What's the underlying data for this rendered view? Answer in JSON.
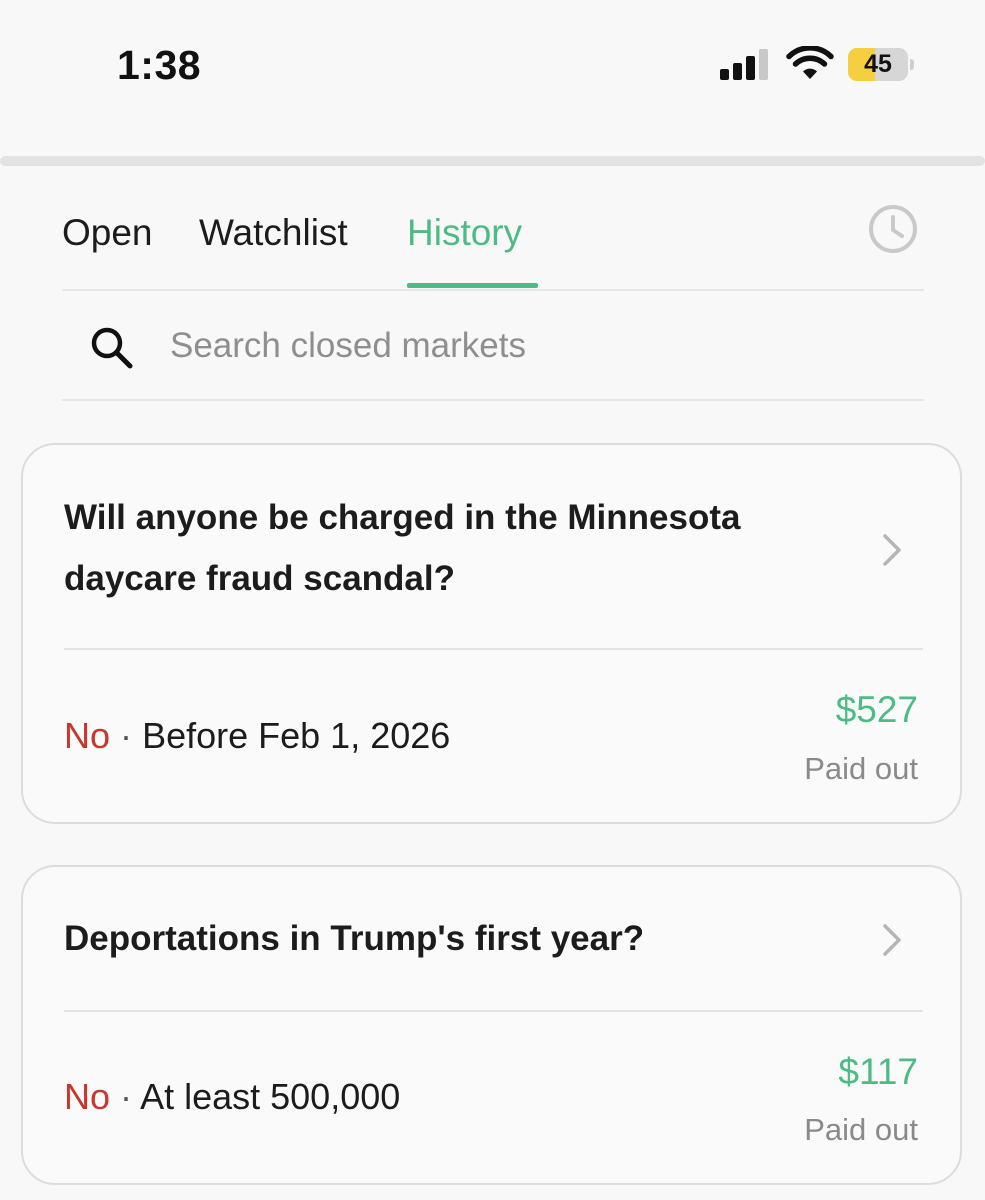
{
  "status_bar": {
    "time": "1:38",
    "battery_level": "45",
    "battery_fraction": 0.45,
    "signal_icon": "cellular-signal-icon",
    "wifi_icon": "wifi-icon",
    "battery_icon": "battery-icon"
  },
  "tabs": [
    {
      "label": "Open",
      "active": false
    },
    {
      "label": "Watchlist",
      "active": false
    },
    {
      "label": "History",
      "active": true
    }
  ],
  "history_icon": "clock-icon",
  "search": {
    "icon": "search-icon",
    "placeholder": "Search closed markets",
    "value": ""
  },
  "markets": [
    {
      "title": "Will anyone be charged in the Minnesota daycare fraud scandal?",
      "side": "No",
      "separator": "·",
      "outcome": "Before Feb 1, 2026",
      "amount": "$527",
      "amount_label": "Paid out"
    },
    {
      "title": "Deportations in Trump's first year?",
      "side": "No",
      "separator": "·",
      "outcome": "At least 500,000",
      "amount": "$117",
      "amount_label": "Paid out"
    }
  ],
  "colors": {
    "accent_green": "#4dbb86",
    "no_red": "#c8372d",
    "background": "#f8f8f8",
    "muted_text": "#8a8a8a"
  }
}
